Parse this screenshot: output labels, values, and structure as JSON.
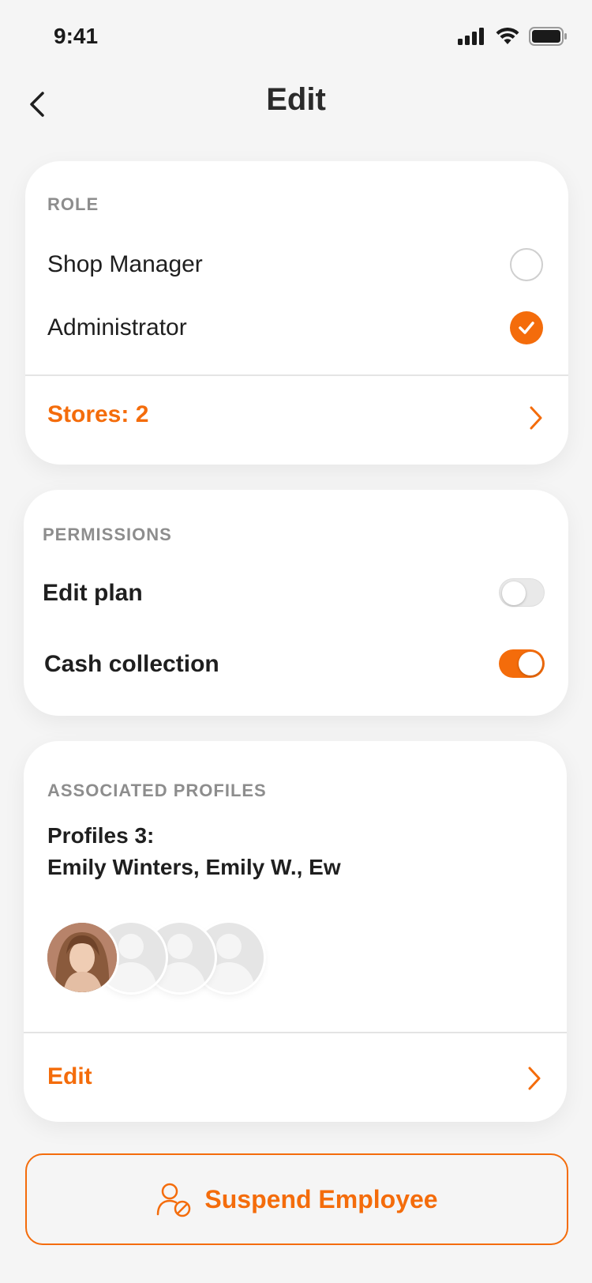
{
  "status": {
    "time": "9:41"
  },
  "nav": {
    "title": "Edit"
  },
  "role": {
    "section_label": "ROLE",
    "options": [
      {
        "label": "Shop Manager",
        "selected": false
      },
      {
        "label": "Administrator",
        "selected": true
      }
    ],
    "stores_label": "Stores: 2"
  },
  "permissions": {
    "section_label": "PERMISSIONS",
    "items": [
      {
        "label": "Edit plan",
        "enabled": false
      },
      {
        "label": "Cash collection",
        "enabled": true
      }
    ]
  },
  "profiles": {
    "section_label": "ASSOCIATED PROFILES",
    "count_line": "Profiles 3:",
    "names_line": "Emily Winters, Emily W., Ew",
    "edit_label": "Edit"
  },
  "actions": {
    "suspend_label": "Suspend Employee"
  },
  "colors": {
    "accent": "#f46c0b",
    "background": "#f5f5f5",
    "card": "#ffffff"
  }
}
